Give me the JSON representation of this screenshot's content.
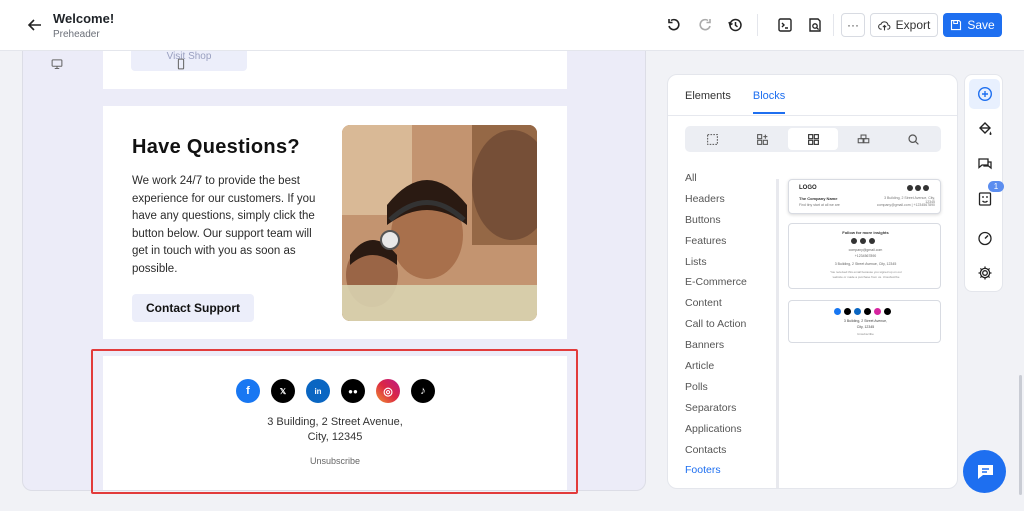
{
  "header": {
    "title": "Welcome!",
    "subtitle": "Preheader",
    "export_label": "Export",
    "save_label": "Save",
    "more_label": "···"
  },
  "canvas": {
    "visit_shop_label": "Visit Shop",
    "questions": {
      "title": "Have Questions?",
      "body": "We work 24/7 to provide the best experience for our customers. If you have any questions, simply click the button below. Our support team will get in touch with you as soon as possible.",
      "button_label": "Contact Support"
    },
    "footer": {
      "socials": [
        {
          "name": "facebook-icon",
          "glyph": "f",
          "color": "#1877f2"
        },
        {
          "name": "x-icon",
          "glyph": "𝕏",
          "color": "#000000"
        },
        {
          "name": "linkedin-icon",
          "glyph": "in",
          "color": "#0a66c2"
        },
        {
          "name": "medium-icon",
          "glyph": "●●",
          "color": "#000000"
        },
        {
          "name": "instagram-icon",
          "glyph": "◎",
          "color": "#d6249f"
        },
        {
          "name": "tiktok-icon",
          "glyph": "♪",
          "color": "#000000"
        }
      ],
      "address_line1": "3 Building, 2 Street Avenue,",
      "address_line2": "City, 12345",
      "unsubscribe": "Unsubscribe"
    }
  },
  "panel": {
    "tabs": [
      {
        "label": "Elements",
        "active": false
      },
      {
        "label": "Blocks",
        "active": true
      }
    ],
    "categories": [
      "All",
      "Headers",
      "Buttons",
      "Features",
      "Lists",
      "E-Commerce",
      "Content",
      "Call to Action",
      "Banners",
      "Article",
      "Polls",
      "Separators",
      "Applications",
      "Contacts",
      "Footers"
    ],
    "active_category": "Footers",
    "thumbs": {
      "logo": "LOGO",
      "company": "The Company Name",
      "tagline": "Find tiny start at all we are",
      "addr_small": "3 Building, 2 Street Avenue, City, 12345",
      "email_small": "company@gmail.com | +1234567890",
      "follow": "Follow for more insights",
      "email2": "company@gmail.com",
      "phone2": "+1234567890",
      "addr2": "3 Building, 2 Street Avenue, City, 12345",
      "notice": "You received this email because you signed up on our website or made a purchase from us. Unsubscribe",
      "addr3": "3 Building, 2 Street Avenue,",
      "city3": "City, 12345",
      "unsub3": "Unsubscribe"
    }
  },
  "side": {
    "badge": "1"
  }
}
